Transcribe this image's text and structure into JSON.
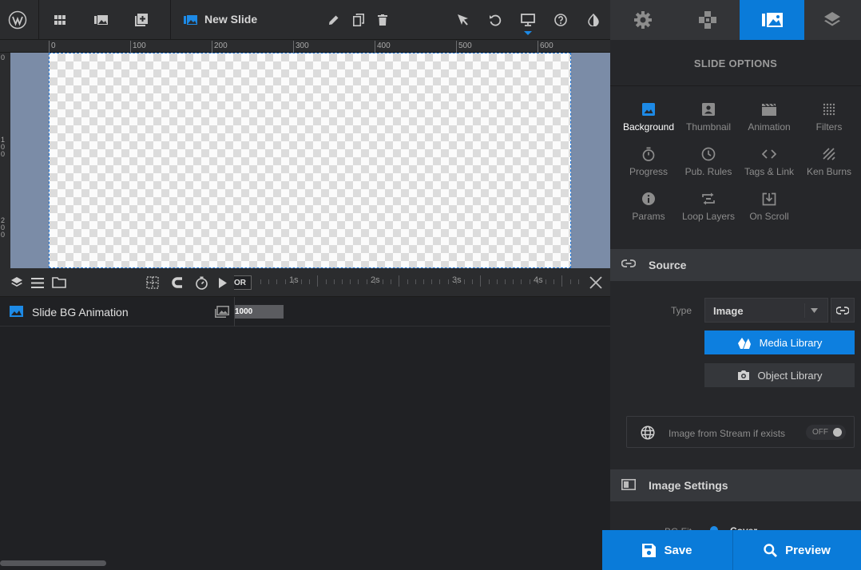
{
  "toolbar": {
    "slide_title": "New Slide"
  },
  "ruler": {
    "top_labels": [
      "0",
      "100",
      "200",
      "300",
      "400",
      "500",
      "600"
    ],
    "left_labels": [
      "0",
      "1\n0\n0",
      "2\n0\n0"
    ]
  },
  "timeline": {
    "start_label": "OR",
    "seconds": [
      "1s",
      "2s",
      "3s",
      "4s"
    ],
    "layer_name": "Slide BG Animation",
    "layer_duration": "1000"
  },
  "panel": {
    "title": "SLIDE OPTIONS",
    "options": [
      {
        "label": "Background",
        "icon": "image-icon",
        "active": true
      },
      {
        "label": "Thumbnail",
        "icon": "portrait-icon"
      },
      {
        "label": "Animation",
        "icon": "film-icon"
      },
      {
        "label": "Filters",
        "icon": "dots-grid-icon"
      },
      {
        "label": "Progress",
        "icon": "stopwatch-icon"
      },
      {
        "label": "Pub. Rules",
        "icon": "clock-icon"
      },
      {
        "label": "Tags & Link",
        "icon": "code-icon"
      },
      {
        "label": "Ken Burns",
        "icon": "ken-burns-icon"
      },
      {
        "label": "Params",
        "icon": "info-icon"
      },
      {
        "label": "Loop Layers",
        "icon": "loop-icon"
      },
      {
        "label": "On Scroll",
        "icon": "download-icon"
      }
    ],
    "source": {
      "heading": "Source",
      "type_label": "Type",
      "type_value": "Image",
      "media_library": "Media Library",
      "object_library": "Object Library",
      "stream_label": "Image from Stream if exists",
      "stream_toggle": "OFF"
    },
    "image_settings": {
      "heading": "Image Settings",
      "bg_fit_label": "BG Fit",
      "bg_fit_value": "Cover"
    }
  },
  "footer": {
    "save": "Save",
    "preview": "Preview"
  },
  "colors": {
    "accent": "#0a7bd9",
    "canvas_bg": "#7b8ca7"
  }
}
